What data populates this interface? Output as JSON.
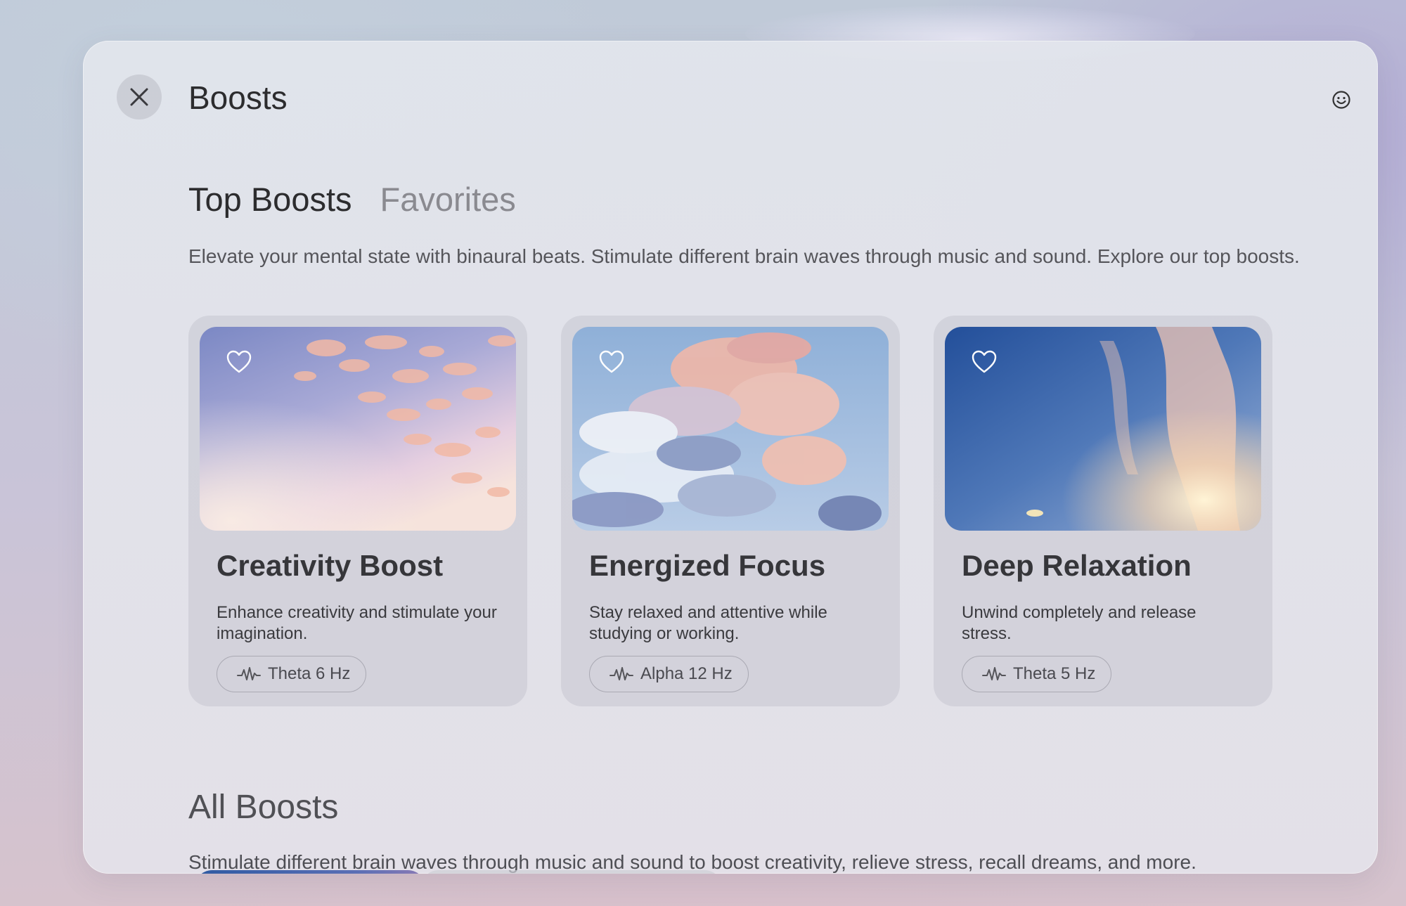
{
  "window": {
    "title": "Boosts",
    "close_icon": "close-icon",
    "emoji_icon": "smiley-icon"
  },
  "tabs": [
    {
      "label": "Top Boosts",
      "active": true
    },
    {
      "label": "Favorites",
      "active": false
    }
  ],
  "intro": "Elevate your mental state with binaural beats. Stimulate different brain waves through music and sound. Explore our top boosts.",
  "top_boosts": [
    {
      "title": "Creativity Boost",
      "description": "Enhance creativity and stimulate your imagination.",
      "frequency": "Theta 6 Hz",
      "icon": "waveform-icon",
      "favorite_icon": "heart-outline-icon",
      "favorited": false
    },
    {
      "title": "Energized Focus",
      "description": "Stay relaxed and attentive while studying or working.",
      "frequency": "Alpha 12 Hz",
      "icon": "waveform-icon",
      "favorite_icon": "heart-outline-icon",
      "favorited": false
    },
    {
      "title": "Deep Relaxation",
      "description": "Unwind completely and release stress.",
      "frequency": "Theta 5 Hz",
      "icon": "waveform-icon",
      "favorite_icon": "heart-outline-icon",
      "favorited": false
    }
  ],
  "all_boosts": {
    "title": "All Boosts",
    "description": "Stimulate different brain waves through music and sound to boost creativity, relieve stress, recall dreams, and more."
  },
  "colors": {
    "text_primary": "#2c2c2e",
    "text_secondary": "#8a8a90",
    "card_bg": "#c6c7cf"
  }
}
